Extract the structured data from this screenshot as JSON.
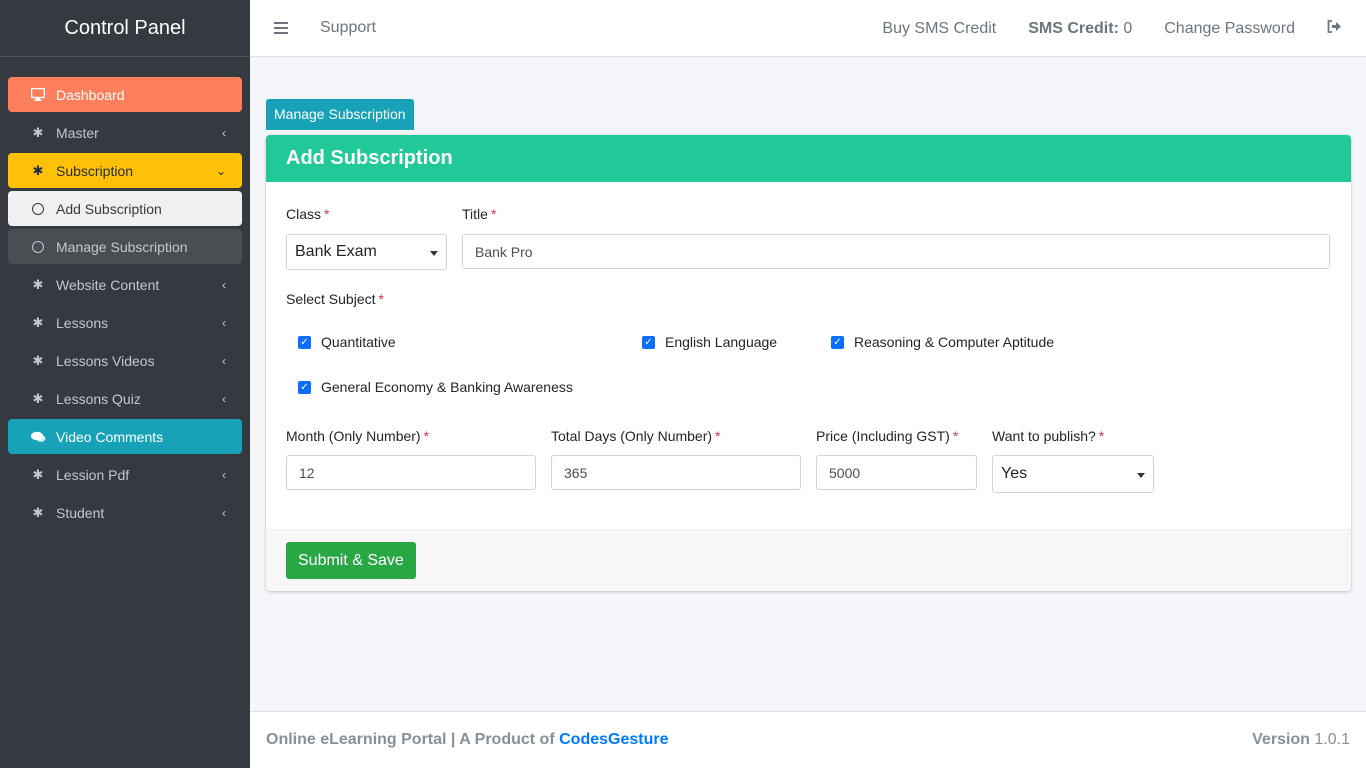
{
  "sidebar": {
    "brand": "Control Panel",
    "items": [
      {
        "label": "Dashboard",
        "icon": "desktop-icon"
      },
      {
        "label": "Master",
        "icon": "gear-icon"
      },
      {
        "label": "Subscription",
        "icon": "gear-icon"
      },
      {
        "label": "Add Subscription",
        "icon": "circle-icon"
      },
      {
        "label": "Manage Subscription",
        "icon": "circle-icon"
      },
      {
        "label": "Website Content",
        "icon": "gear-icon"
      },
      {
        "label": "Lessons",
        "icon": "gear-icon"
      },
      {
        "label": "Lessons Videos",
        "icon": "gear-icon"
      },
      {
        "label": "Lessons Quiz",
        "icon": "gear-icon"
      },
      {
        "label": "Video Comments",
        "icon": "comments-icon"
      },
      {
        "label": "Lession Pdf",
        "icon": "gear-icon"
      },
      {
        "label": "Student",
        "icon": "gear-icon"
      }
    ]
  },
  "topbar": {
    "support": "Support",
    "buy_sms": "Buy SMS Credit",
    "sms_credit_label": "SMS Credit:",
    "sms_credit_value": "0",
    "change_password": "Change Password"
  },
  "main": {
    "manage_button": "Manage Subscription",
    "card_title": "Add Subscription",
    "form": {
      "class_label": "Class",
      "class_value": "Bank Exam",
      "title_label": "Title",
      "title_value": "Bank Pro",
      "subject_label": "Select Subject",
      "subjects": [
        "Quantitative",
        "English Language",
        "Reasoning & Computer Aptitude",
        "General Economy & Banking Awareness"
      ],
      "month_label": "Month (Only Number)",
      "month_value": "12",
      "days_label": "Total Days (Only Number)",
      "days_value": "365",
      "price_label": "Price (Including GST)",
      "price_value": "5000",
      "publish_label": "Want to publish?",
      "publish_value": "Yes",
      "required_mark": "*"
    },
    "submit_button": "Submit & Save"
  },
  "footer": {
    "text": "Online eLearning Portal | A Product of",
    "brand": "CodesGesture",
    "version_label": "Version",
    "version_value": "1.0.1"
  },
  "colors": {
    "sidebar_bg": "#343a40",
    "dashboard": "#fd7e5a",
    "subscription": "#ffc107",
    "video_comments": "#17a2b8",
    "card_header": "#20c997",
    "submit": "#28a745"
  }
}
